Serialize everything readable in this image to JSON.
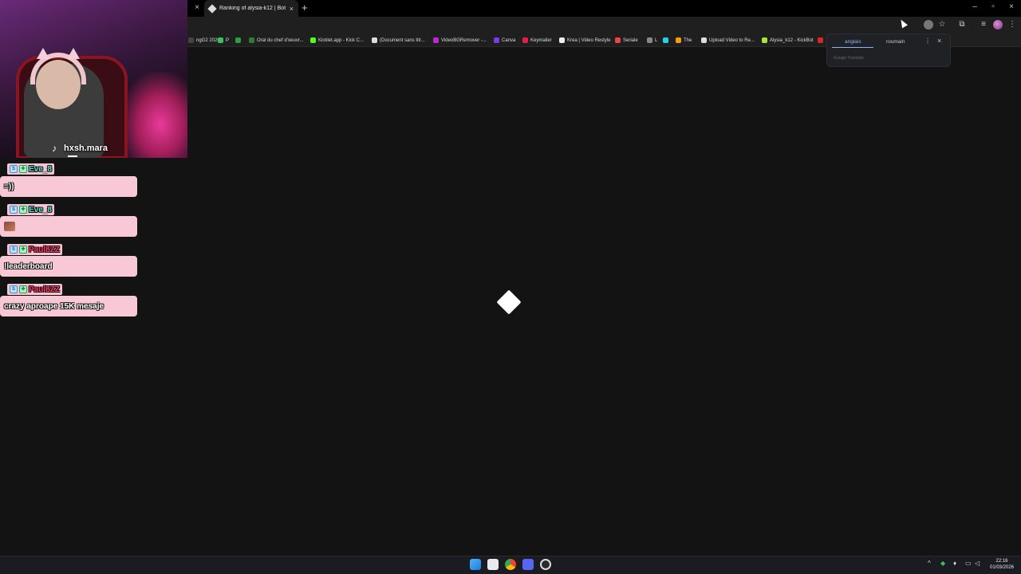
{
  "browser": {
    "prev_tab_close": "×",
    "active_tab_title": "Ranking of alysia-k12 | BotRix",
    "active_tab_close": "×",
    "new_tab": "+",
    "window_controls": {
      "minimize": "–",
      "maximize": "▫",
      "close": "×"
    }
  },
  "toolbar_icons": [
    "puzzle-icon",
    "star-icon",
    "extensions-icon",
    "media-icon",
    "menu-icon"
  ],
  "bookmarks": [
    {
      "label": "ngG2 2026",
      "color": "#444444"
    },
    {
      "label": "P",
      "color": "#3fbf5a"
    },
    {
      "label": "",
      "color": "#2e9d3f"
    },
    {
      "label": "Oral du chef d'oeuvr...",
      "color": "#2e7d32"
    },
    {
      "label": "Kicklet.app - Kick C...",
      "color": "#53fc18"
    },
    {
      "label": "(Document sans titr...",
      "color": "#dddddd"
    },
    {
      "label": "VideoBGRemover -...",
      "color": "#c026d3"
    },
    {
      "label": "Canva",
      "color": "#7c3aed"
    },
    {
      "label": "Keymailer",
      "color": "#e11d48"
    },
    {
      "label": "Krea | Video Restyle",
      "color": "#eeeeee"
    },
    {
      "label": "Seriale",
      "color": "#ef4444"
    },
    {
      "label": "L",
      "color": "#888888"
    },
    {
      "label": "",
      "color": "#22d3ee"
    },
    {
      "label": "The",
      "color": "#f59e0b"
    },
    {
      "label": "Upload Video to Re...",
      "color": "#dddddd"
    },
    {
      "label": "Alysia_k12 - KickBot",
      "color": "#a3e635"
    },
    {
      "label": "",
      "color": "#dc2626"
    }
  ],
  "translate": {
    "lang_from": "anglais",
    "lang_to": "roumain",
    "more": "⋮",
    "close": "×",
    "brand": "Google Translate"
  },
  "cam": {
    "handle": "hxsh.mara",
    "tiktok_glyph": "♪"
  },
  "chat": [
    {
      "user": "Eve_8",
      "color": "teal",
      "text": "=))",
      "emote": false
    },
    {
      "user": "Eve_8",
      "color": "teal",
      "text": "",
      "emote": true
    },
    {
      "user": "Paul8ZZ",
      "color": "red",
      "text": "!leaderboard",
      "emote": false
    },
    {
      "user": "Paul8ZZ",
      "color": "red",
      "text": "crazy aproape 15K mesaje",
      "emote": false
    }
  ],
  "taskbar": {
    "tray_arrow": "^",
    "clock_time": "22:16",
    "clock_date": "01/03/2026"
  }
}
